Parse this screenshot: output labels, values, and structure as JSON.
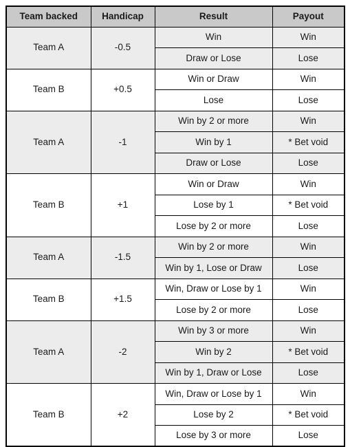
{
  "table": {
    "columns": [
      {
        "key": "team_backed",
        "label": "Team backed"
      },
      {
        "key": "handicap",
        "label": "Handicap"
      },
      {
        "key": "result",
        "label": "Result"
      },
      {
        "key": "payout",
        "label": "Payout"
      }
    ],
    "colors": {
      "header_background": "#c9c9c9",
      "band_light_background": "#ececec",
      "band_plain_background": "#ffffff",
      "border": "#000000",
      "text": "#1a1a1a"
    },
    "groups": [
      {
        "team_backed": "Team A",
        "handicap": "-0.5",
        "band": "light",
        "rows": [
          {
            "result": "Win",
            "payout": "Win"
          },
          {
            "result": "Draw or Lose",
            "payout": "Lose"
          }
        ]
      },
      {
        "team_backed": "Team B",
        "handicap": "+0.5",
        "band": "plain",
        "rows": [
          {
            "result": "Win or Draw",
            "payout": "Win"
          },
          {
            "result": "Lose",
            "payout": "Lose"
          }
        ]
      },
      {
        "team_backed": "Team A",
        "handicap": "-1",
        "band": "light",
        "rows": [
          {
            "result": "Win by 2 or more",
            "payout": "Win"
          },
          {
            "result": "Win by 1",
            "payout": "* Bet void"
          },
          {
            "result": "Draw or Lose",
            "payout": "Lose"
          }
        ]
      },
      {
        "team_backed": "Team B",
        "handicap": "+1",
        "band": "plain",
        "rows": [
          {
            "result": "Win or Draw",
            "payout": "Win"
          },
          {
            "result": "Lose by 1",
            "payout": "* Bet void"
          },
          {
            "result": "Lose by 2 or more",
            "payout": "Lose"
          }
        ]
      },
      {
        "team_backed": "Team A",
        "handicap": "-1.5",
        "band": "light",
        "rows": [
          {
            "result": "Win by 2 or more",
            "payout": "Win"
          },
          {
            "result": "Win by 1, Lose or Draw",
            "payout": "Lose"
          }
        ]
      },
      {
        "team_backed": "Team B",
        "handicap": "+1.5",
        "band": "plain",
        "rows": [
          {
            "result": "Win, Draw or Lose by 1",
            "payout": "Win"
          },
          {
            "result": "Lose by 2 or more",
            "payout": "Lose"
          }
        ]
      },
      {
        "team_backed": "Team A",
        "handicap": "-2",
        "band": "light",
        "rows": [
          {
            "result": "Win by 3 or more",
            "payout": "Win"
          },
          {
            "result": "Win by 2",
            "payout": "* Bet void"
          },
          {
            "result": "Win by 1, Draw or Lose",
            "payout": "Lose"
          }
        ]
      },
      {
        "team_backed": "Team B",
        "handicap": "+2",
        "band": "plain",
        "rows": [
          {
            "result": "Win, Draw or Lose by 1",
            "payout": "Win"
          },
          {
            "result": "Lose by 2",
            "payout": "* Bet void"
          },
          {
            "result": "Lose by 3 or more",
            "payout": "Lose"
          }
        ]
      }
    ]
  }
}
